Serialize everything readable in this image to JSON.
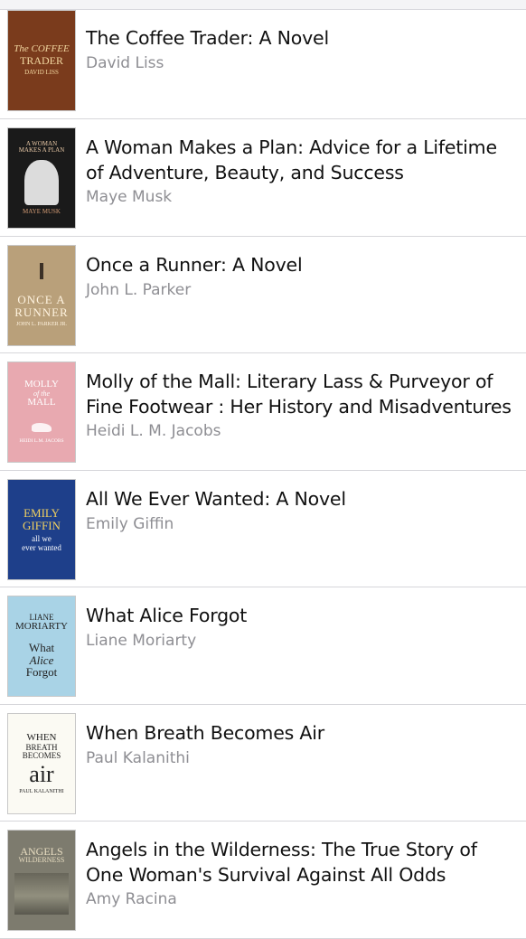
{
  "books": [
    {
      "title": "The Coffee Trader: A Novel",
      "author": "David Liss",
      "cover": {
        "lines": [
          "The COFFEE",
          "TRADER",
          "DAVID LISS"
        ],
        "bg": "#7a3b1c",
        "fg": "#f2d7a0"
      }
    },
    {
      "title": "A Woman Makes a Plan: Advice for a Lifetime of Adventure, Beauty, and Success",
      "author": "Maye Musk",
      "cover": {
        "lines": [
          "A WOMAN",
          "MAKES A PLAN",
          "MAYE MUSK"
        ],
        "bg": "#1a1a1a",
        "fg": "#e7c7a5"
      }
    },
    {
      "title": "Once a Runner: A Novel",
      "author": "John L. Parker",
      "cover": {
        "lines": [
          "ONCE A",
          "RUNNER",
          "JOHN L. PARKER JR."
        ],
        "bg": "#b9a07a",
        "fg": "#fff3df"
      }
    },
    {
      "title": "Molly of the Mall: Literary Lass & Purveyor of Fine Footwear : Her History and Misadventures",
      "author": "Heidi L. M. Jacobs",
      "cover": {
        "lines": [
          "MOLLY",
          "of the",
          "MALL",
          "HEIDI L.M. JACOBS"
        ],
        "bg": "#e8a9b0",
        "fg": "#ffffff"
      }
    },
    {
      "title": "All We Ever Wanted: A Novel",
      "author": "Emily Giffin",
      "cover": {
        "lines": [
          "EMILY",
          "GIFFIN",
          "all we",
          "ever wanted"
        ],
        "bg": "#1e3f8a",
        "fg": "#f0d060"
      }
    },
    {
      "title": "What Alice Forgot",
      "author": "Liane Moriarty",
      "cover": {
        "lines": [
          "LIANE",
          "MORIARTY",
          "What",
          "Alice",
          "Forgot"
        ],
        "bg": "#a9d3e6",
        "fg": "#222222"
      }
    },
    {
      "title": "When Breath Becomes Air",
      "author": "Paul Kalanithi",
      "cover": {
        "lines": [
          "WHEN",
          "BREATH",
          "BECOMES",
          "air",
          "PAUL KALANITHI"
        ],
        "bg": "#fbfaf3",
        "fg": "#222222"
      }
    },
    {
      "title": "Angels in the Wilderness: The True Story of One Woman's Survival Against All Odds",
      "author": "Amy Racina",
      "cover": {
        "lines": [
          "ANGELS",
          "WILDERNESS"
        ],
        "bg": "#7d7b6e",
        "fg": "#e7dcc0"
      }
    }
  ]
}
